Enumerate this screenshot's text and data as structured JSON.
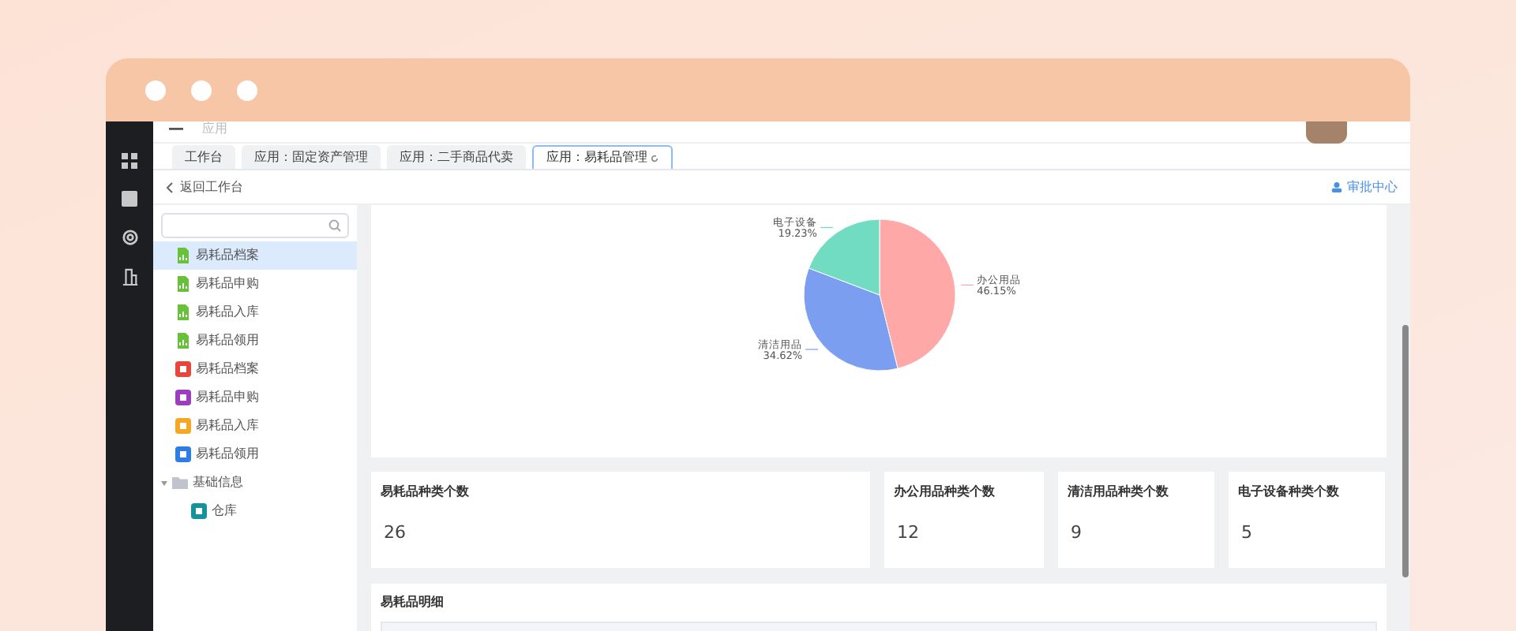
{
  "header": {
    "title": "应用"
  },
  "tabs": [
    {
      "label": "工作台",
      "selected": false,
      "refresh": false
    },
    {
      "label": "应用：固定资产管理",
      "selected": false,
      "refresh": false
    },
    {
      "label": "应用：二手商品代卖",
      "selected": false,
      "refresh": false
    },
    {
      "label": "应用：易耗品管理",
      "selected": true,
      "refresh": true
    }
  ],
  "back_link": "返回工作台",
  "approval_link": "审批中心",
  "tree": [
    {
      "kind": "file",
      "label": "易耗品档案",
      "color": "#67c23a",
      "selected": true
    },
    {
      "kind": "file",
      "label": "易耗品申购",
      "color": "#67c23a",
      "selected": false
    },
    {
      "kind": "file",
      "label": "易耗品入库",
      "color": "#67c23a",
      "selected": false
    },
    {
      "kind": "file",
      "label": "易耗品领用",
      "color": "#67c23a",
      "selected": false
    },
    {
      "kind": "app",
      "label": "易耗品档案",
      "color": "#e8453c",
      "selected": false
    },
    {
      "kind": "app",
      "label": "易耗品申购",
      "color": "#9c3fbf",
      "selected": false
    },
    {
      "kind": "app",
      "label": "易耗品入库",
      "color": "#f5a623",
      "selected": false
    },
    {
      "kind": "app",
      "label": "易耗品领用",
      "color": "#2f7de1",
      "selected": false
    },
    {
      "kind": "folder",
      "label": "基础信息",
      "color": "#c0c4cc",
      "selected": false,
      "expanded": true,
      "children": [
        {
          "kind": "app",
          "label": "仓库",
          "color": "#15939a",
          "selected": false
        }
      ]
    }
  ],
  "pie": {
    "chart_data": {
      "type": "pie",
      "categories": [
        "办公用品",
        "清洁用品",
        "电子设备"
      ],
      "series": [
        {
          "values": [
            46.15,
            34.62,
            19.23
          ]
        }
      ],
      "colors": [
        "#ffa8a8",
        "#7b9ef0",
        "#72dcc2"
      ],
      "value_labels": [
        "46.15%",
        "34.62%",
        "19.23%"
      ]
    }
  },
  "stats": [
    {
      "label": "易耗品种类个数",
      "value": "26"
    },
    {
      "label": "办公用品种类个数",
      "value": "12"
    },
    {
      "label": "清洁用品种类个数",
      "value": "9"
    },
    {
      "label": "电子设备种类个数",
      "value": "5"
    }
  ],
  "detail": {
    "title": "易耗品明细"
  }
}
